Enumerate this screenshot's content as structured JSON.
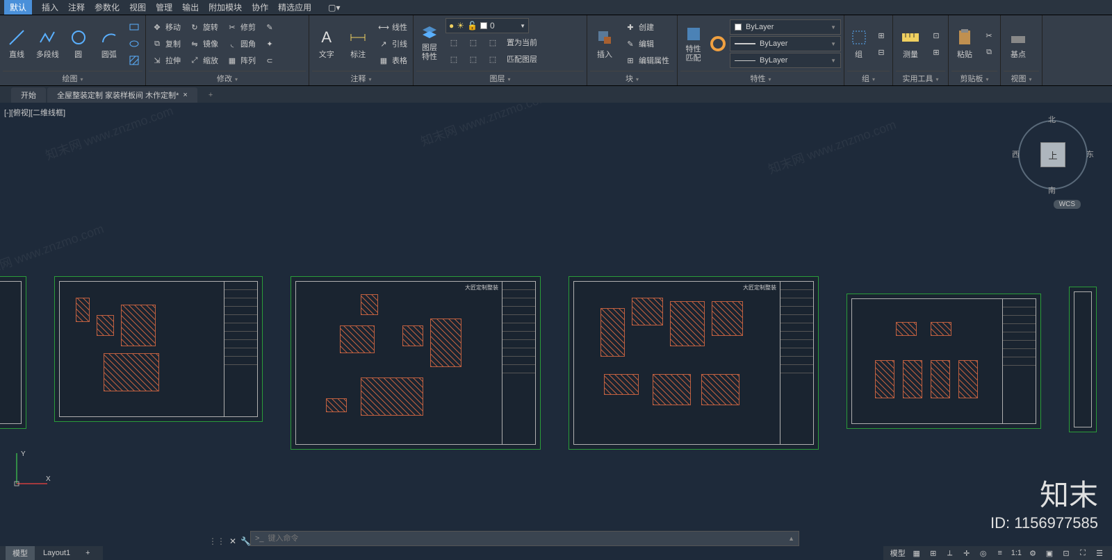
{
  "menu": {
    "items": [
      "默认",
      "插入",
      "注释",
      "参数化",
      "视图",
      "管理",
      "输出",
      "附加模块",
      "协作",
      "精选应用"
    ],
    "active": 0
  },
  "ribbon": {
    "draw": {
      "title": "绘图",
      "line": "直线",
      "pline": "多段线",
      "circle": "圆",
      "arc": "圆弧"
    },
    "modify": {
      "title": "修改",
      "move": "移动",
      "rotate": "旋转",
      "trim": "修剪",
      "copy": "复制",
      "mirror": "镜像",
      "fillet": "圆角",
      "stretch": "拉伸",
      "scale": "缩放",
      "array": "阵列"
    },
    "annot": {
      "title": "注释",
      "text": "文字",
      "dim": "标注",
      "linetype": "线性",
      "leader": "引线",
      "table": "表格"
    },
    "layers": {
      "title": "图层",
      "props": "图层\n特性",
      "current": "0",
      "setcur": "置为当前",
      "match": "匹配图层"
    },
    "block": {
      "title": "块",
      "insert": "插入",
      "create": "创建",
      "edit": "编辑",
      "editattr": "编辑属性"
    },
    "props": {
      "title": "特性",
      "match": "特性\n匹配",
      "bylayer": "ByLayer"
    },
    "group": {
      "title": "组",
      "group": "组"
    },
    "util": {
      "title": "实用工具",
      "measure": "测量"
    },
    "clip": {
      "title": "剪贴板",
      "paste": "粘贴"
    },
    "view": {
      "title": "视图",
      "base": "基点"
    }
  },
  "tabs": {
    "start": "开始",
    "file": "全屋整装定制 家装样板间 木作定制*",
    "close": "×",
    "plus": "+"
  },
  "viewport": {
    "label": "[-][俯视][二维线框]"
  },
  "viewcube": {
    "top": "上",
    "n": "北",
    "s": "南",
    "e": "东",
    "w": "西",
    "wcs": "WCS"
  },
  "ucs": {
    "x": "X",
    "y": "Y"
  },
  "cmdline": {
    "placeholder": "键入命令",
    "prompt": ">_"
  },
  "layouts": {
    "model": "模型",
    "layout1": "Layout1",
    "plus": "+"
  },
  "status": {
    "model": "模型",
    "scale": "1:1"
  },
  "watermark": {
    "brand": "知末",
    "site": "知末网 www.znzmo.com",
    "id": "ID: 1156977585"
  },
  "sheet_titles": [
    "大匠定制整装",
    "大匠定制整装"
  ]
}
